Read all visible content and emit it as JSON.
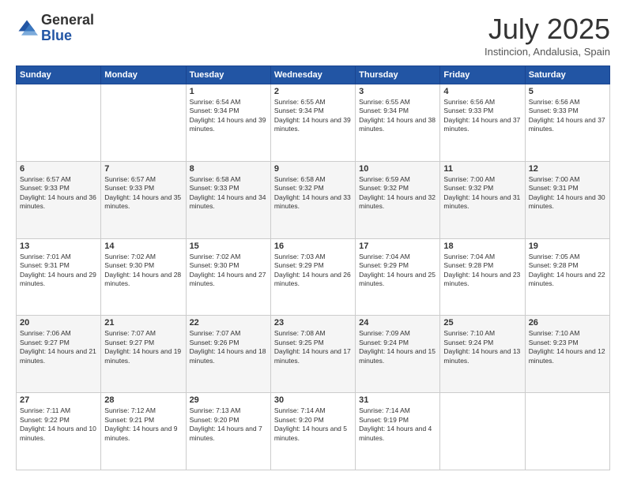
{
  "header": {
    "logo_general": "General",
    "logo_blue": "Blue",
    "month_title": "July 2025",
    "location": "Instincion, Andalusia, Spain"
  },
  "weekdays": [
    "Sunday",
    "Monday",
    "Tuesday",
    "Wednesday",
    "Thursday",
    "Friday",
    "Saturday"
  ],
  "weeks": [
    [
      {
        "day": "",
        "text": ""
      },
      {
        "day": "",
        "text": ""
      },
      {
        "day": "1",
        "text": "Sunrise: 6:54 AM\nSunset: 9:34 PM\nDaylight: 14 hours and 39 minutes."
      },
      {
        "day": "2",
        "text": "Sunrise: 6:55 AM\nSunset: 9:34 PM\nDaylight: 14 hours and 39 minutes."
      },
      {
        "day": "3",
        "text": "Sunrise: 6:55 AM\nSunset: 9:34 PM\nDaylight: 14 hours and 38 minutes."
      },
      {
        "day": "4",
        "text": "Sunrise: 6:56 AM\nSunset: 9:33 PM\nDaylight: 14 hours and 37 minutes."
      },
      {
        "day": "5",
        "text": "Sunrise: 6:56 AM\nSunset: 9:33 PM\nDaylight: 14 hours and 37 minutes."
      }
    ],
    [
      {
        "day": "6",
        "text": "Sunrise: 6:57 AM\nSunset: 9:33 PM\nDaylight: 14 hours and 36 minutes."
      },
      {
        "day": "7",
        "text": "Sunrise: 6:57 AM\nSunset: 9:33 PM\nDaylight: 14 hours and 35 minutes."
      },
      {
        "day": "8",
        "text": "Sunrise: 6:58 AM\nSunset: 9:33 PM\nDaylight: 14 hours and 34 minutes."
      },
      {
        "day": "9",
        "text": "Sunrise: 6:58 AM\nSunset: 9:32 PM\nDaylight: 14 hours and 33 minutes."
      },
      {
        "day": "10",
        "text": "Sunrise: 6:59 AM\nSunset: 9:32 PM\nDaylight: 14 hours and 32 minutes."
      },
      {
        "day": "11",
        "text": "Sunrise: 7:00 AM\nSunset: 9:32 PM\nDaylight: 14 hours and 31 minutes."
      },
      {
        "day": "12",
        "text": "Sunrise: 7:00 AM\nSunset: 9:31 PM\nDaylight: 14 hours and 30 minutes."
      }
    ],
    [
      {
        "day": "13",
        "text": "Sunrise: 7:01 AM\nSunset: 9:31 PM\nDaylight: 14 hours and 29 minutes."
      },
      {
        "day": "14",
        "text": "Sunrise: 7:02 AM\nSunset: 9:30 PM\nDaylight: 14 hours and 28 minutes."
      },
      {
        "day": "15",
        "text": "Sunrise: 7:02 AM\nSunset: 9:30 PM\nDaylight: 14 hours and 27 minutes."
      },
      {
        "day": "16",
        "text": "Sunrise: 7:03 AM\nSunset: 9:29 PM\nDaylight: 14 hours and 26 minutes."
      },
      {
        "day": "17",
        "text": "Sunrise: 7:04 AM\nSunset: 9:29 PM\nDaylight: 14 hours and 25 minutes."
      },
      {
        "day": "18",
        "text": "Sunrise: 7:04 AM\nSunset: 9:28 PM\nDaylight: 14 hours and 23 minutes."
      },
      {
        "day": "19",
        "text": "Sunrise: 7:05 AM\nSunset: 9:28 PM\nDaylight: 14 hours and 22 minutes."
      }
    ],
    [
      {
        "day": "20",
        "text": "Sunrise: 7:06 AM\nSunset: 9:27 PM\nDaylight: 14 hours and 21 minutes."
      },
      {
        "day": "21",
        "text": "Sunrise: 7:07 AM\nSunset: 9:27 PM\nDaylight: 14 hours and 19 minutes."
      },
      {
        "day": "22",
        "text": "Sunrise: 7:07 AM\nSunset: 9:26 PM\nDaylight: 14 hours and 18 minutes."
      },
      {
        "day": "23",
        "text": "Sunrise: 7:08 AM\nSunset: 9:25 PM\nDaylight: 14 hours and 17 minutes."
      },
      {
        "day": "24",
        "text": "Sunrise: 7:09 AM\nSunset: 9:24 PM\nDaylight: 14 hours and 15 minutes."
      },
      {
        "day": "25",
        "text": "Sunrise: 7:10 AM\nSunset: 9:24 PM\nDaylight: 14 hours and 13 minutes."
      },
      {
        "day": "26",
        "text": "Sunrise: 7:10 AM\nSunset: 9:23 PM\nDaylight: 14 hours and 12 minutes."
      }
    ],
    [
      {
        "day": "27",
        "text": "Sunrise: 7:11 AM\nSunset: 9:22 PM\nDaylight: 14 hours and 10 minutes."
      },
      {
        "day": "28",
        "text": "Sunrise: 7:12 AM\nSunset: 9:21 PM\nDaylight: 14 hours and 9 minutes."
      },
      {
        "day": "29",
        "text": "Sunrise: 7:13 AM\nSunset: 9:20 PM\nDaylight: 14 hours and 7 minutes."
      },
      {
        "day": "30",
        "text": "Sunrise: 7:14 AM\nSunset: 9:20 PM\nDaylight: 14 hours and 5 minutes."
      },
      {
        "day": "31",
        "text": "Sunrise: 7:14 AM\nSunset: 9:19 PM\nDaylight: 14 hours and 4 minutes."
      },
      {
        "day": "",
        "text": ""
      },
      {
        "day": "",
        "text": ""
      }
    ]
  ]
}
